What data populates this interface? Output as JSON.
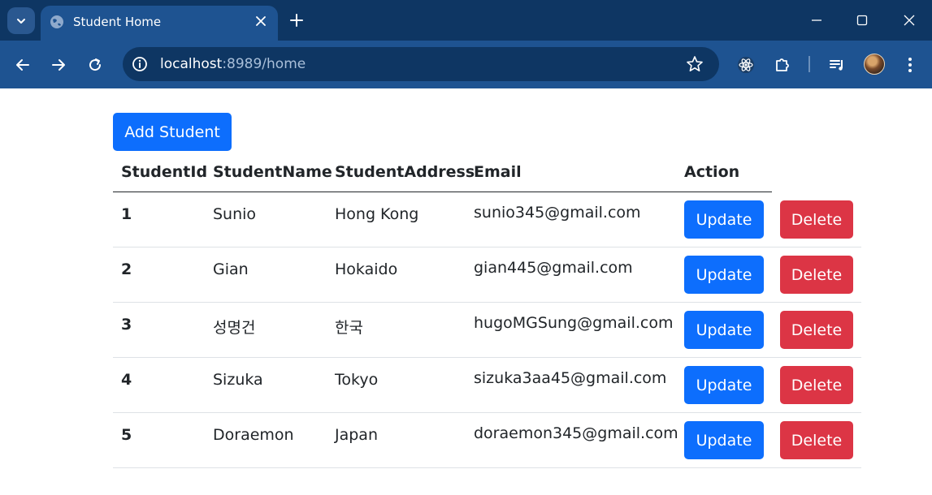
{
  "browser": {
    "tab_title": "Student Home",
    "url_host": "localhost",
    "url_path": ":8989/home",
    "icons": [
      "tab-search-icon",
      "globe-icon",
      "close-icon",
      "plus-icon",
      "minimize-icon",
      "maximize-icon",
      "window-close-icon",
      "back-arrow-icon",
      "forward-arrow-icon",
      "reload-icon",
      "info-icon",
      "star-icon",
      "react-devtools-icon",
      "extensions-icon",
      "media-queue-icon",
      "profile-avatar",
      "more-vert-icon"
    ],
    "colors": {
      "tabstrip": "#0e3663",
      "toolbar": "#1e5391"
    }
  },
  "page": {
    "add_button": "Add Student",
    "headers": {
      "id": "StudentId",
      "name": "StudentName",
      "address": "StudentAddress",
      "email": "Email",
      "action": "Action"
    },
    "update_label": "Update",
    "delete_label": "Delete",
    "rows": [
      {
        "id": "1",
        "name": "Sunio",
        "address": "Hong Kong",
        "email": "sunio345@gmail.com"
      },
      {
        "id": "2",
        "name": "Gian",
        "address": "Hokaido",
        "email": "gian445@gmail.com"
      },
      {
        "id": "3",
        "name": "성명건",
        "address": "한국",
        "email": "hugoMGSung@gmail.com"
      },
      {
        "id": "4",
        "name": "Sizuka",
        "address": "Tokyo",
        "email": "sizuka3aa45@gmail.com"
      },
      {
        "id": "5",
        "name": "Doraemon",
        "address": "Japan",
        "email": "doraemon345@gmail.com"
      }
    ],
    "colors": {
      "primary": "#0d6efd",
      "danger": "#dc3545"
    }
  }
}
